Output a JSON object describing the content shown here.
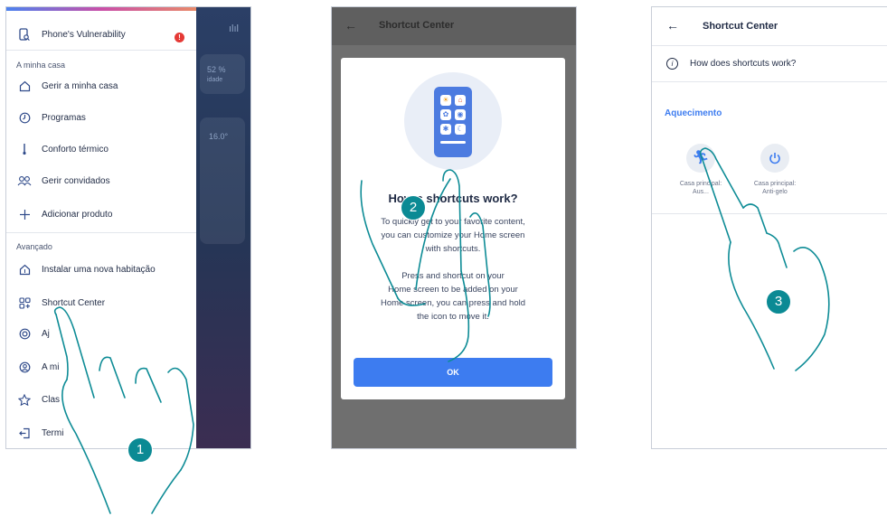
{
  "screen1": {
    "background": {
      "val1": "52 %",
      "val1_sub": "idade",
      "val2": "16.0°"
    },
    "menu": {
      "top_item": {
        "label": "Phone's Vulnerability",
        "badge": "!"
      },
      "section_home": "A minha casa",
      "home_items": [
        {
          "label": "Gerir a minha casa",
          "icon": "house-icon"
        },
        {
          "label": "Programas",
          "icon": "clock-icon"
        },
        {
          "label": "Conforto térmico",
          "icon": "thermometer-icon"
        },
        {
          "label": "Gerir convidados",
          "icon": "guests-icon"
        },
        {
          "label": "Adicionar produto",
          "icon": "plus-icon"
        }
      ],
      "section_advanced": "Avançado",
      "advanced_items": [
        {
          "label": "Instalar uma nova habitação",
          "icon": "house-add-icon"
        },
        {
          "label": "Shortcut Center",
          "icon": "shortcut-grid-icon"
        },
        {
          "label": "Aj",
          "icon": "help-icon"
        },
        {
          "label": "A mi",
          "icon": "user-icon"
        },
        {
          "label": "Clas",
          "icon": "star-icon"
        },
        {
          "label": "Termi",
          "icon": "logout-icon"
        }
      ]
    }
  },
  "screen2": {
    "header": {
      "title": "Shortcut Center"
    },
    "dialog": {
      "title": "How      s shortcuts work?",
      "para1": [
        "To quickly get to your favorite content,",
        "you can customize your Home screen",
        "with shortcuts."
      ],
      "para2": [
        "Press and     shortcut on your",
        "Home screen to be added on your",
        "Home screen, you can press and hold",
        "the icon to move it."
      ],
      "ok_label": "OK"
    }
  },
  "screen3": {
    "header": {
      "title": "Shortcut Center"
    },
    "info": "How does shortcuts work?",
    "section": "Aquecimento",
    "shortcuts": [
      {
        "line1": "Casa principal:",
        "line2": "Aus...",
        "icon": "running-person-icon"
      },
      {
        "line1": "Casa principal:",
        "line2": "Anti-gelo",
        "icon": "power-icon"
      }
    ]
  },
  "steps": [
    "1",
    "2",
    "3"
  ],
  "colors": {
    "accent": "#3d7cf0",
    "step": "#0b8a94",
    "alert": "#e53935"
  }
}
